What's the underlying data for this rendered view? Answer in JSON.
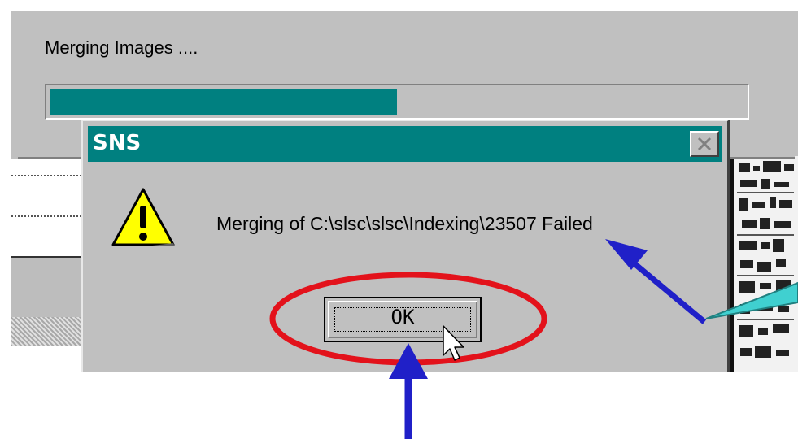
{
  "progress_dialog": {
    "label": "Merging Images ....",
    "progress_fraction": 0.5
  },
  "message_box": {
    "title": "SNS",
    "message": "Merging of C:\\slsc\\slsc\\Indexing\\23507 Failed",
    "ok_label": "OK",
    "icon": "warning-icon"
  },
  "annotations": {
    "circle_color": "#e3121b",
    "arrow_color": "#2020c8",
    "callout_color": "#40d0d0"
  }
}
